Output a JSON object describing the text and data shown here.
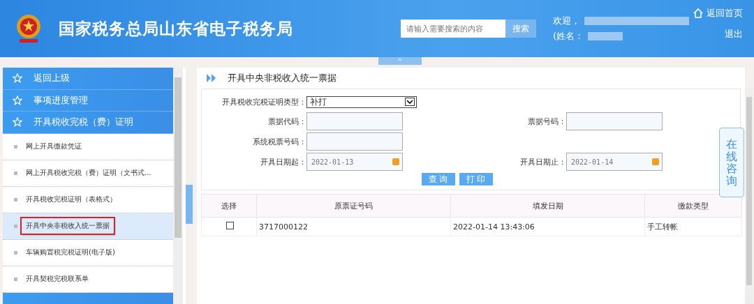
{
  "header": {
    "title": "国家税务总局山东省电子税务局",
    "search": {
      "placeholder": "请输入需要搜索的内容",
      "button": "搜索"
    },
    "welcome": "欢迎，",
    "name_label": "(姓名：",
    "home_link": "返回首页",
    "logout": "退出",
    "collapse": "^"
  },
  "sidebar": {
    "items": [
      {
        "label": "返回上级",
        "kind": "group",
        "selected": false
      },
      {
        "label": "事项进度管理",
        "kind": "group",
        "selected": false
      },
      {
        "label": "开具税收完税（费）证明",
        "kind": "group",
        "selected": false
      },
      {
        "label": "网上开具缴款凭证",
        "kind": "sub",
        "selected": false
      },
      {
        "label": "网上开具税收完税（费）证明（文书式...",
        "kind": "sub",
        "selected": false
      },
      {
        "label": "开具税收完税证明（表格式）",
        "kind": "sub",
        "selected": false
      },
      {
        "label": "开具中央非税收入统一票据",
        "kind": "sub",
        "selected": true
      },
      {
        "label": "车辆购置税完税证明(电子版)",
        "kind": "sub",
        "selected": false
      },
      {
        "label": "开具契税完税联系单",
        "kind": "sub",
        "selected": false
      }
    ]
  },
  "page": {
    "title": "开具中央非税收入统一票据",
    "form": {
      "type_label": "开具税收完税证明类型：",
      "type_value": "补打",
      "code_label": "票据代码：",
      "number_label": "票据号码：",
      "system_label": "系统税票号码：",
      "start_label": "开具日期起：",
      "start_value": "2022-01-13",
      "end_label": "开具日期止：",
      "end_value": "2022-01-14",
      "buttons": [
        "查 询",
        "打 印"
      ]
    },
    "table": {
      "columns": [
        "选择",
        "原票证号码",
        "填发日期",
        "缴款类型"
      ],
      "rows": [
        {
          "checked": false,
          "cells": [
            "",
            "3717000122",
            "2022-01-14 13:43:06",
            "手工转帐"
          ]
        }
      ]
    }
  },
  "consult": "在线咨询"
}
